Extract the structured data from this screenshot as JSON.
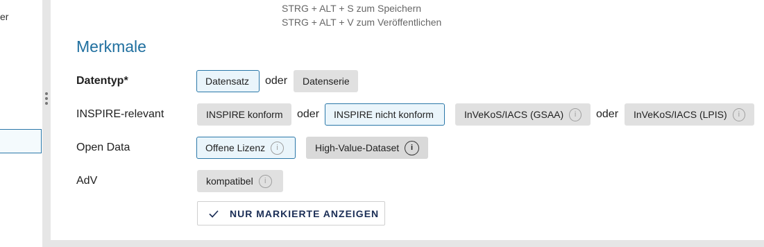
{
  "sidebar": {
    "partial_text": "er"
  },
  "hints": {
    "save": "STRG + ALT + S zum Speichern",
    "publish": "STRG + ALT + V zum Veröffentlichen"
  },
  "section": {
    "title": "Merkmale"
  },
  "rows": {
    "datentyp": {
      "label": "Datentyp*",
      "chip1": "Datensatz",
      "or": "oder",
      "chip2": "Datenserie"
    },
    "inspire": {
      "label": "INSPIRE-relevant",
      "chip1": "INSPIRE konform",
      "or1": "oder",
      "chip2": "INSPIRE nicht konform",
      "chip3": "InVeKoS/IACS (GSAA)",
      "or2": "oder",
      "chip4": "InVeKoS/IACS (LPIS)"
    },
    "opendata": {
      "label": "Open Data",
      "chip1": "Offene Lizenz",
      "chip2": "High-Value-Dataset"
    },
    "adv": {
      "label": "AdV",
      "chip1": "kompatibel"
    }
  },
  "button": {
    "label": "NUR MARKIERTE ANZEIGEN"
  },
  "icons": {
    "info": "info-icon",
    "check": "check-icon",
    "grip": "drag-handle-icon"
  },
  "colors": {
    "accent": "#1f6f9f",
    "selected_border": "#2a77a8",
    "selected_bg": "#eaf5fb",
    "chip_bg": "#e0e0e0"
  }
}
